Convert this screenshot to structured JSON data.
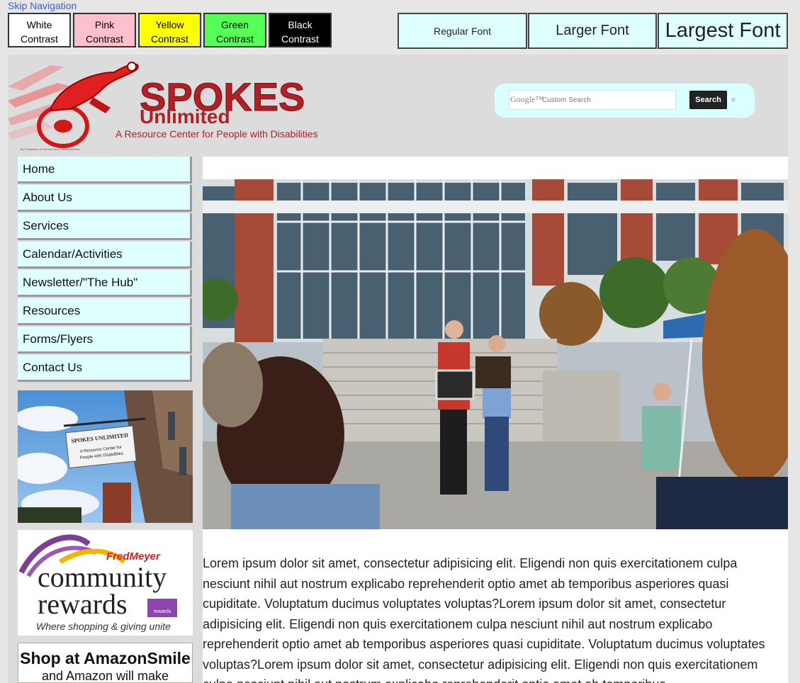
{
  "skip_nav": "Skip Navigation",
  "contrast": [
    {
      "line1": "White",
      "line2": "Contrast",
      "bg": "#ffffff",
      "fg": "#000000"
    },
    {
      "line1": "Pink",
      "line2": "Contrast",
      "bg": "#ffc0cb",
      "fg": "#000000"
    },
    {
      "line1": "Yellow",
      "line2": "Contrast",
      "bg": "#ffff00",
      "fg": "#000000"
    },
    {
      "line1": "Green",
      "line2": "Contrast",
      "bg": "#55ff55",
      "fg": "#000000"
    },
    {
      "line1": "Black",
      "line2": "Contrast",
      "bg": "#000000",
      "fg": "#ffffff"
    }
  ],
  "font_sizes": {
    "regular": "Regular Font",
    "larger": "Larger Font",
    "largest": "Largest Font"
  },
  "logo": {
    "line1": "SPOKES",
    "line2": "Unlimited",
    "tagline": "A Resource Center for People with Disabilities",
    "credit": "By Permission of Johnny Hart & News America"
  },
  "search": {
    "brand": "Google™",
    "placeholder": "Custom Search",
    "button": "Search",
    "clear": "×"
  },
  "nav": [
    "Home",
    "About Us",
    "Services",
    "Calendar/Activities",
    "Newsletter/\"The Hub\"",
    "Resources",
    "Forms/Flyers",
    "Contact Us"
  ],
  "sidebar": {
    "sign_text": [
      "SPOKES UNLIMITED",
      "A Resource Center for",
      "People with Disabilities"
    ],
    "fredmeyer_brand": "FredMeyer",
    "fredmeyer_line1": "community",
    "fredmeyer_line2": "rewards",
    "fredmeyer_card": "rewards",
    "fredmeyer_tagline": "Where shopping & giving unite",
    "amazon_title": "Shop at AmazonSmile",
    "amazon_sub": "and Amazon will make"
  },
  "body_text": "Lorem ipsum dolor sit amet, consectetur adipisicing elit. Eligendi non quis exercitationem culpa nesciunt nihil aut nostrum explicabo reprehenderit optio amet ab temporibus asperiores quasi cupiditate. Voluptatum ducimus voluptates voluptas?Lorem ipsum dolor sit amet, consectetur adipisicing elit. Eligendi non quis exercitationem culpa nesciunt nihil aut nostrum explicabo reprehenderit optio amet ab temporibus asperiores quasi cupiditate. Voluptatum ducimus voluptates voluptas?Lorem ipsum dolor sit amet, consectetur adipisicing elit. Eligendi non quis exercitationem culpa nesciunt nihil aut nostrum explicabo reprehenderit optio amet ab temporibus",
  "colors": {
    "nav_bg": "#dfffff",
    "logo_red": "#b21f24",
    "link": "#3a64c8"
  }
}
